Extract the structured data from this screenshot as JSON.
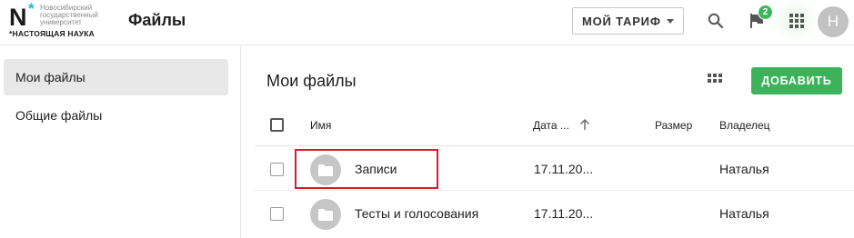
{
  "header": {
    "logo": {
      "mark": "N",
      "university_lines": [
        "Новосибирский",
        "государственный",
        "университет"
      ],
      "tagline": "*НАСТОЯЩАЯ НАУКА"
    },
    "app_title": "Файлы",
    "tariff_label": "МОЙ ТАРИФ",
    "notifications_count": "2",
    "avatar_initial": "Н"
  },
  "sidebar": {
    "items": [
      {
        "label": "Мои файлы",
        "active": true
      },
      {
        "label": "Общие файлы",
        "active": false
      }
    ]
  },
  "main": {
    "title": "Мои файлы",
    "add_label": "ДОБАВИТЬ",
    "columns": {
      "name": "Имя",
      "date": "Дата ...",
      "size": "Размер",
      "owner": "Владелец"
    },
    "rows": [
      {
        "icon": "folder-icon",
        "name": "Записи",
        "date": "17.11.20...",
        "size": "",
        "owner": "Наталья",
        "highlighted": true
      },
      {
        "icon": "folder-icon",
        "name": "Тесты и голосования",
        "date": "17.11.20...",
        "size": "",
        "owner": "Наталья",
        "highlighted": false
      }
    ]
  },
  "colors": {
    "accent_green": "#3cb25a",
    "badge_green": "#3db860",
    "highlight_red": "#d21f2c",
    "logo_star_blue": "#1fb4e6"
  }
}
